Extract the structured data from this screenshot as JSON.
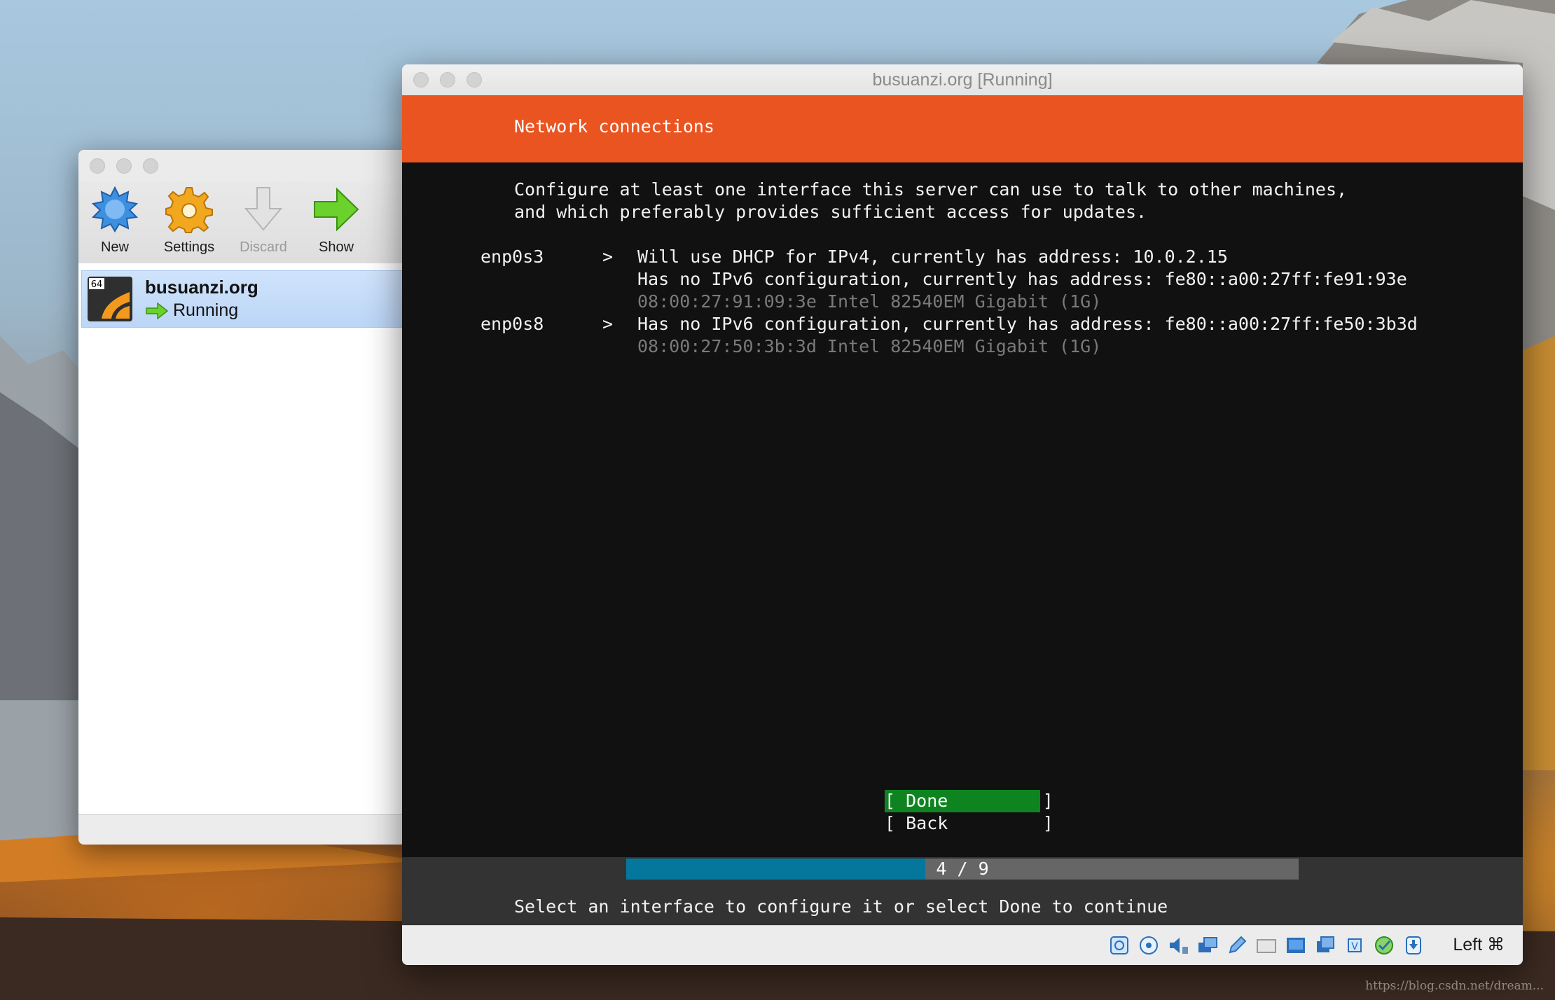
{
  "manager": {
    "toolbar": {
      "new_label": "New",
      "settings_label": "Settings",
      "discard_label": "Discard",
      "show_label": "Show"
    },
    "vm": {
      "badge": "64",
      "name": "busuanzi.org",
      "state": "Running"
    }
  },
  "vm_window": {
    "title": "busuanzi.org [Running]",
    "screen": {
      "header": "Network connections",
      "intro_line1": "Configure at least one interface this server can use to talk to other machines,",
      "intro_line2": "and which preferably provides sufficient access for updates.",
      "interfaces": [
        {
          "name": "enp0s3",
          "arrow": ">",
          "line1": "Will use DHCP for IPv4, currently has address: 10.0.2.15",
          "line2": "Has no IPv6 configuration, currently has address: fe80::a00:27ff:fe91:93e",
          "hw": "08:00:27:91:09:3e Intel 82540EM Gigabit (1G)"
        },
        {
          "name": "enp0s8",
          "arrow": ">",
          "line1": "Has no IPv6 configuration, currently has address: fe80::a00:27ff:fe50:3b3d",
          "hw": "08:00:27:50:3b:3d Intel 82540EM Gigabit (1G)"
        }
      ],
      "done_button": "[ Done         ]",
      "back_button": "[ Back         ]",
      "progress": {
        "text": "4 / 9",
        "current": 4,
        "total": 9
      },
      "footer": "Select an interface to configure it or select Done to continue"
    },
    "statusbar": {
      "host_key": "Left ⌘"
    }
  },
  "watermark": "https://blog.csdn.net/dream...",
  "colors": {
    "ubuntu_orange": "#e95420",
    "done_green": "#0e8420",
    "progress_blue": "#06779c"
  }
}
